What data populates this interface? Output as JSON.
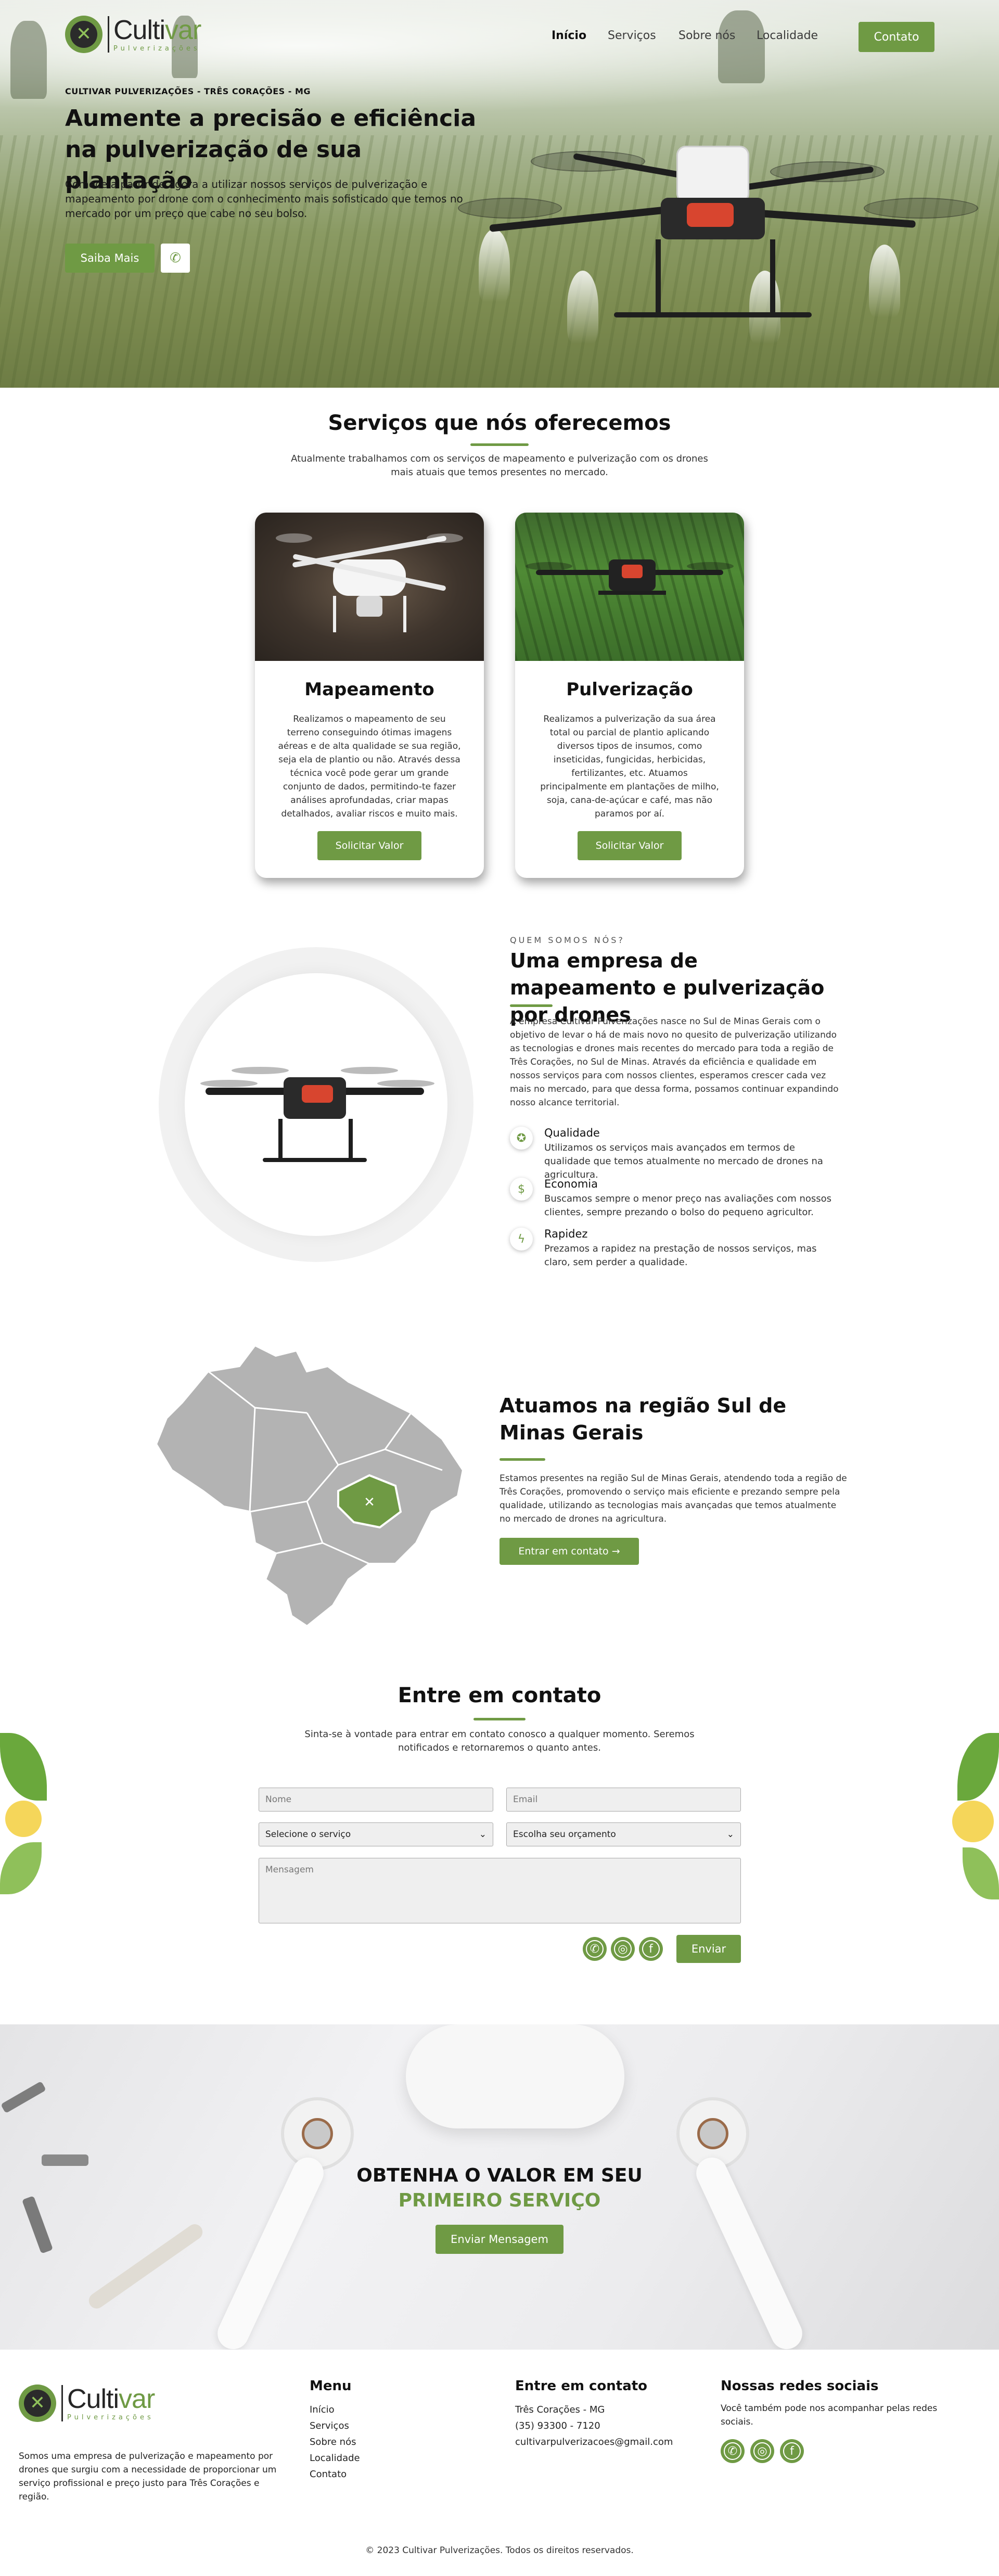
{
  "brand": {
    "name_main": "Culti",
    "name_accent": "var",
    "tagline": "Pulverizações"
  },
  "nav": {
    "items": [
      "Início",
      "Serviços",
      "Sobre nós",
      "Localidade"
    ],
    "cta": "Contato"
  },
  "hero": {
    "kicker": "CULTIVAR PULVERIZAÇÕES - TRÊS CORAÇÕES - MG",
    "title": "Aumente a precisão e eficiência na pulverização de sua plantação",
    "text": "Comece a partir de agora a utilizar nossos serviços de pulverização e mapeamento por drone com o conhecimento mais sofisticado que temos no mercado por um preço que cabe no seu bolso.",
    "primary_button": "Saiba Mais",
    "whatsapp_icon": "whatsapp-icon"
  },
  "services": {
    "title": "Serviços que nós oferecemos",
    "subtitle": "Atualmente trabalhamos com os serviços de mapeamento e pulverização com os drones mais atuais que temos presentes no mercado.",
    "cards": [
      {
        "title": "Mapeamento",
        "text": "Realizamos o mapeamento de seu terreno conseguindo ótimas imagens aéreas e de alta qualidade se sua região, seja ela de plantio ou não. Através dessa técnica você pode gerar um grande conjunto de dados, permitindo-te fazer análises aprofundadas, criar mapas detalhados, avaliar riscos e muito mais.",
        "button": "Solicitar Valor"
      },
      {
        "title": "Pulverização",
        "text": "Realizamos a pulverização da sua área total ou parcial de plantio aplicando diversos tipos de insumos, como inseticidas, fungicidas, herbicidas, fertilizantes, etc. Atuamos principalmente em plantações de milho, soja, cana-de-açúcar e café, mas não paramos por aí.",
        "button": "Solicitar Valor"
      }
    ]
  },
  "about": {
    "kicker": "QUEM SOMOS NÓS?",
    "title": "Uma empresa de mapeamento e pulverização por drones",
    "text": "A empresa Cultivar Pulverizações nasce no Sul de Minas Gerais com o objetivo de levar o há de mais novo no quesito de pulverização utilizando as tecnologias e drones mais recentes do mercado para toda a região de Três Corações, no Sul de Minas. Através da eficiência e qualidade em nossos serviços para com nossos clientes, esperamos crescer cada vez mais no mercado, para que dessa forma, possamos continuar expandindo nosso alcance territorial.",
    "features": [
      {
        "icon": "quality-badge-icon",
        "title": "Qualidade",
        "text": "Utilizamos os serviços mais avançados em termos de qualidade que temos atualmente no mercado de drones na agricultura."
      },
      {
        "icon": "money-icon",
        "title": "Economia",
        "text": "Buscamos sempre o menor preço nas avaliações com nossos clientes, sempre prezando o bolso do pequeno agricultor."
      },
      {
        "icon": "lightning-icon",
        "title": "Rapidez",
        "text": "Prezamos a rapidez na prestação de nossos serviços, mas claro, sem perder a qualidade."
      }
    ]
  },
  "region": {
    "title": "Atuamos na região Sul de Minas Gerais",
    "text": "Estamos presentes na região Sul de Minas Gerais, atendendo toda a região de Três Corações, promovendo o serviço mais eficiente e prezando sempre pela qualidade, utilizando as tecnologias mais avançadas que temos atualmente no mercado de drones na agricultura.",
    "button": "Entrar em contato →"
  },
  "contact": {
    "title": "Entre em contato",
    "subtitle": "Sinta-se à vontade para entrar em contato conosco a qualquer momento. Seremos notificados e retornaremos o quanto antes.",
    "name_placeholder": "Nome",
    "email_placeholder": "Email",
    "service_select": "Selecione o serviço",
    "budget_select": "Escolha seu orçamento",
    "message_placeholder": "Mensagem",
    "send_button": "Enviar",
    "socials": [
      "whatsapp-icon",
      "instagram-icon",
      "facebook-icon"
    ]
  },
  "cta": {
    "line1": "OBTENHA O VALOR EM SEU",
    "line2": "PRIMEIRO SERVIÇO",
    "button": "Enviar Mensagem"
  },
  "footer": {
    "about": "Somos uma empresa de pulverização e mapeamento por drones que surgiu com a necessidade de proporcionar um serviço profissional e preço justo para Três Corações e região.",
    "menu_title": "Menu",
    "menu": [
      "Início",
      "Serviços",
      "Sobre nós",
      "Localidade",
      "Contato"
    ],
    "contact_title": "Entre em contato",
    "contact_lines": [
      "Três Corações - MG",
      "(35) 93300 - 7120",
      "cultivarpulverizacoes@gmail.com"
    ],
    "social_title": "Nossas redes sociais",
    "social_text": "Você também pode nos acompanhar pelas redes sociais.",
    "copyright": "© 2023 Cultivar Pulverizações. Todos os direitos reservados."
  },
  "colors": {
    "accent": "#6f9a44",
    "text": "#111111",
    "field_bg": "#efefef"
  }
}
